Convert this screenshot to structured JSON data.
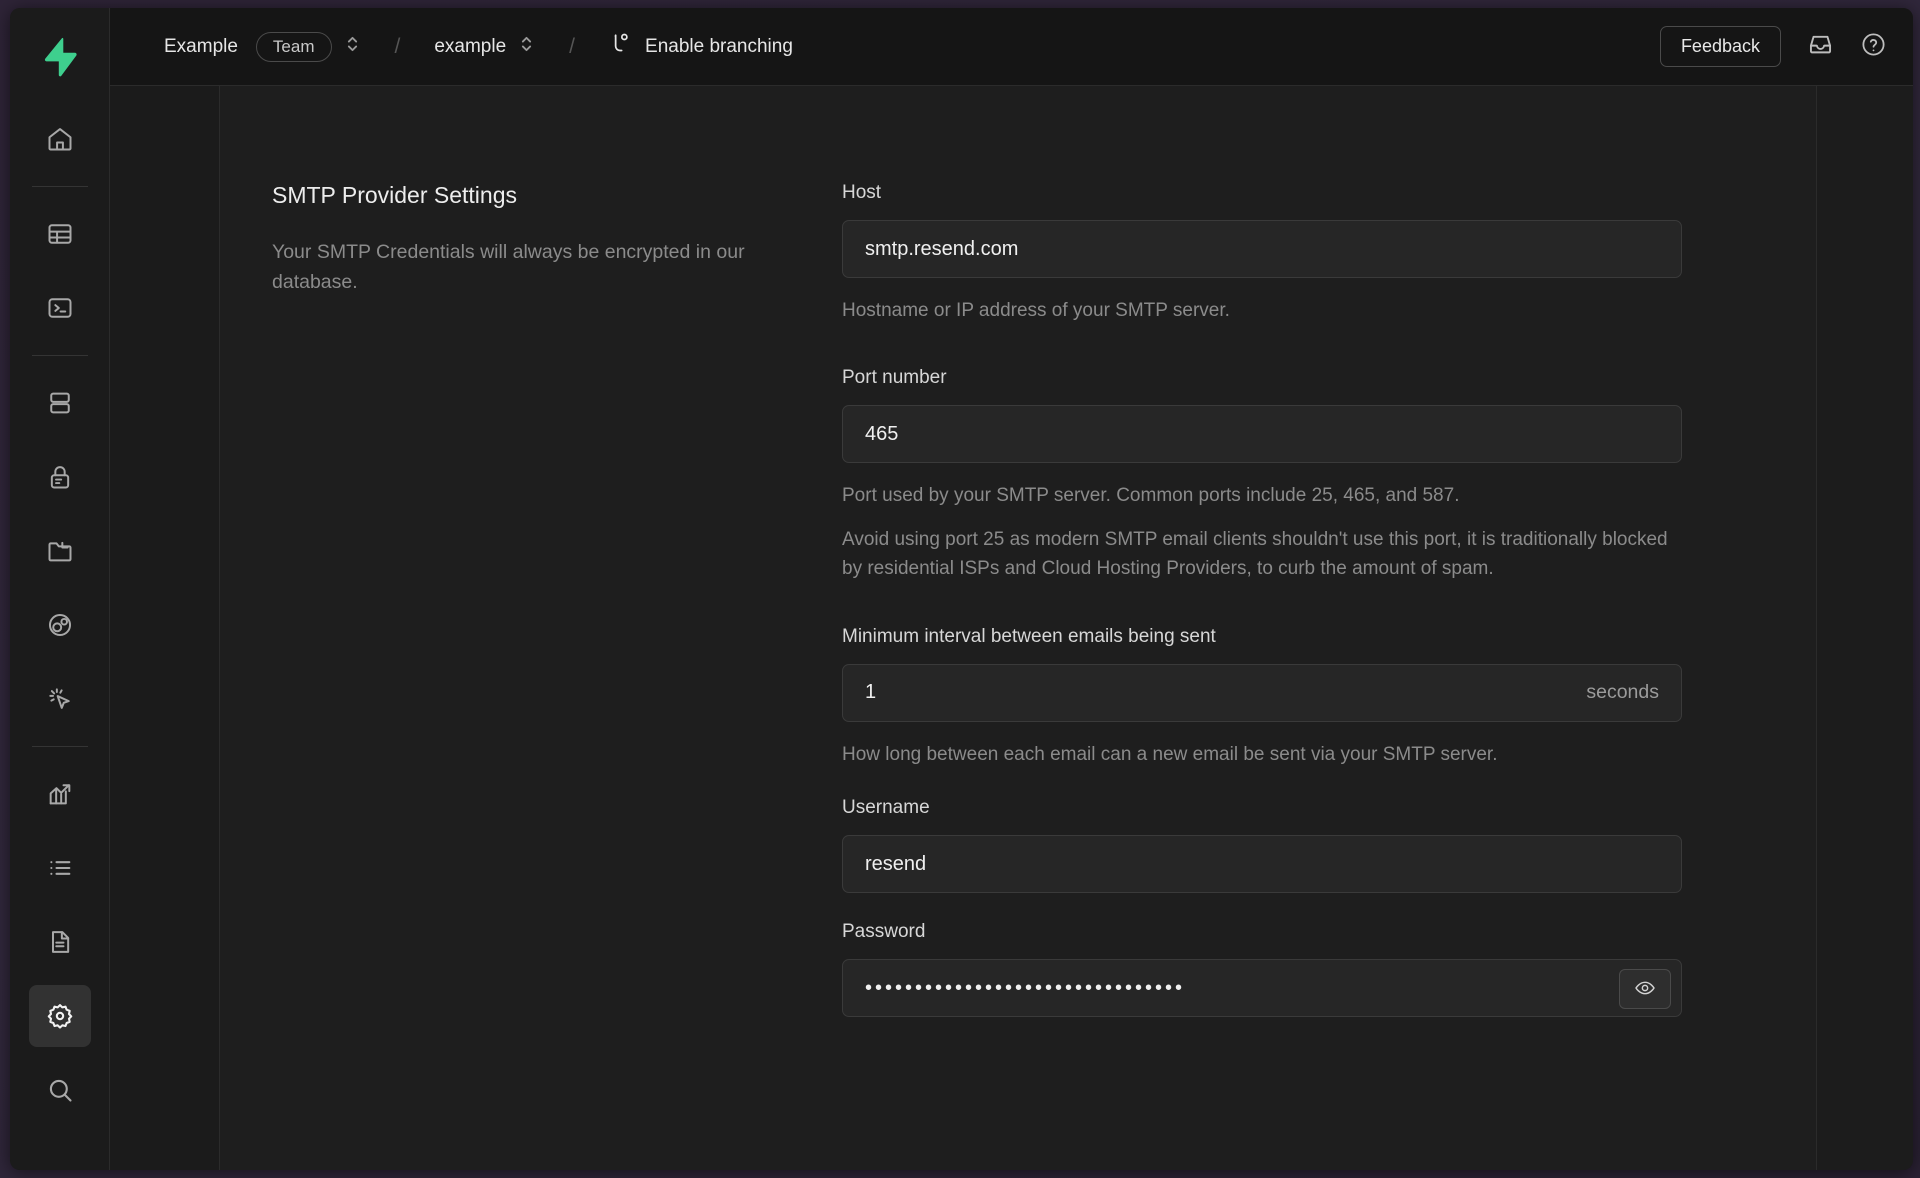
{
  "breadcrumb": {
    "org": "Example",
    "team_badge": "Team",
    "project": "example",
    "branching_label": "Enable branching",
    "separator": "/"
  },
  "topbar": {
    "feedback_label": "Feedback",
    "inbox_icon": "inbox-icon",
    "help_icon": "help-circle-icon"
  },
  "sidebar": {
    "logo_icon": "supabase-logo-icon",
    "items": [
      {
        "name": "home",
        "icon": "home-icon",
        "active": false
      },
      {
        "name": "table-editor",
        "icon": "table-icon",
        "active": false
      },
      {
        "name": "sql-editor",
        "icon": "terminal-icon",
        "active": false
      },
      {
        "name": "database",
        "icon": "database-icon",
        "active": false
      },
      {
        "name": "authentication",
        "icon": "lock-icon",
        "active": false
      },
      {
        "name": "storage",
        "icon": "folder-icon",
        "active": false
      },
      {
        "name": "edge-functions",
        "icon": "edge-function-icon",
        "active": false
      },
      {
        "name": "realtime",
        "icon": "cursor-click-icon",
        "active": false
      },
      {
        "name": "reports",
        "icon": "chart-icon",
        "active": false
      },
      {
        "name": "logs",
        "icon": "list-icon",
        "active": false
      },
      {
        "name": "api-docs",
        "icon": "document-icon",
        "active": false
      },
      {
        "name": "project-settings",
        "icon": "gear-icon",
        "active": true
      },
      {
        "name": "search",
        "icon": "search-icon",
        "active": false
      }
    ]
  },
  "main": {
    "section_title": "SMTP Provider Settings",
    "section_description": "Your SMTP Credentials will always be encrypted in our database.",
    "fields": {
      "host": {
        "label": "Host",
        "value": "smtp.resend.com",
        "placeholder": "smtp.resend.com",
        "help": "Hostname or IP address of your SMTP server."
      },
      "port": {
        "label": "Port number",
        "value": "465",
        "placeholder": "465",
        "help": "Port used by your SMTP server. Common ports include 25, 465, and 587.",
        "help2": "Avoid using port 25 as modern SMTP email clients shouldn't use this port, it is traditionally blocked by residential ISPs and Cloud Hosting Providers, to curb the amount of spam."
      },
      "interval": {
        "label": "Minimum interval between emails being sent",
        "value": "1",
        "placeholder": "1",
        "suffix": "seconds",
        "help": "How long between each email can a new email be sent via your SMTP server."
      },
      "username": {
        "label": "Username",
        "value": "resend",
        "placeholder": "resend"
      },
      "password": {
        "label": "Password",
        "value": "••••••••••••••••••••••••••••••••",
        "placeholder": "",
        "toggle_icon": "eye-icon"
      }
    }
  },
  "colors": {
    "brand_green": "#3ECF8E",
    "window_bg": "#1c1c1c",
    "panel_bg": "#1e1e1e",
    "input_bg": "#262626",
    "desktop_bg": "#2b2236"
  }
}
